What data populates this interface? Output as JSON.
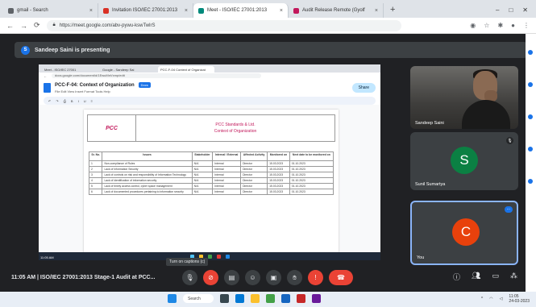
{
  "browser": {
    "tabs": [
      {
        "label": "gmail - Search",
        "color": "#5f6368",
        "active": false
      },
      {
        "label": "Invitation ISO/IEC 27001:2013",
        "color": "#d93025",
        "active": false
      },
      {
        "label": "Meet - ISO/IEC 27001:2013",
        "color": "#00897b",
        "active": true
      },
      {
        "label": "Audit Release Remote (Gyolf",
        "color": "#c2185b",
        "active": false
      }
    ],
    "new_tab": "+",
    "url": "https://meet.google.com/abv-pywu-kswTwlrS"
  },
  "meet": {
    "presenting_banner": "Sandeep Saini is presenting",
    "presenter_initial": "S",
    "meeting_label": "11:05 AM | ISO/IEC 27001:2013 Stage-1 Audit at PCC...",
    "tooltip": "Turn on captions (c)"
  },
  "shared_screen": {
    "tabs": [
      "Meet - ISO/IEC 27001",
      "Google - Sandeep Sai",
      "PCC-F-04 Context of Organizat"
    ],
    "address": "docs.google.com/document/d/1EwuMnVxmp/edit",
    "doc_title": "PCC-F-04: Context of Organization",
    "doc_badge": "Docs",
    "doc_menu": "File Edit View Insert Format Tools Help",
    "share_label": "Share",
    "logo_text": "PCC",
    "header_company": "PCC Standards & Ltd.",
    "header_subtitle": "Context of Organization",
    "table_headers": [
      "Sr. No.",
      "Issues",
      "Stakeholder",
      "Internal / External",
      "Affected Activity",
      "Monitored on",
      "Next date to be monitored on"
    ],
    "table_rows": [
      [
        "1",
        "Non-compliance of Rules",
        "N/A",
        "Internal",
        "Director",
        "15.03.2023",
        "01.10.2023"
      ],
      [
        "2",
        "Lack of Information Security",
        "N/A",
        "Internal",
        "Director",
        "15.03.2023",
        "01.10.2023"
      ],
      [
        "3",
        "Lack of controls on risk and responsibility of Information Technology",
        "N/A",
        "Internal",
        "Director",
        "15.03.2023",
        "01.10.2023"
      ],
      [
        "4",
        "Lack of identification of information security",
        "N/A",
        "Internal",
        "Director",
        "15.03.2023",
        "01.10.2023"
      ],
      [
        "5",
        "Lack of timely access control, cyber space management",
        "N/A",
        "Internal",
        "Director",
        "15.03.2023",
        "01.10.2023"
      ],
      [
        "6",
        "Lack of documented procedures pertaining to information security",
        "N/A",
        "Internal",
        "Director",
        "15.03.2023",
        "01.10.2023"
      ]
    ],
    "taskbar_time": "11:05 AM"
  },
  "participants": [
    {
      "name": "Sandeep Saini",
      "type": "video"
    },
    {
      "name": "Sunil Sumartya",
      "initial": "S",
      "color": "#0b8043"
    },
    {
      "name": "You",
      "initial": "C",
      "color": "#e8410c"
    }
  ],
  "controls": {
    "mic_icon": "mic-icon",
    "cam_icon": "camera-off-icon",
    "leave_icon": "call-end-icon"
  },
  "taskbar": {
    "search_label": "Search",
    "clock_time": "11:05",
    "clock_date": "24-03-2023"
  }
}
